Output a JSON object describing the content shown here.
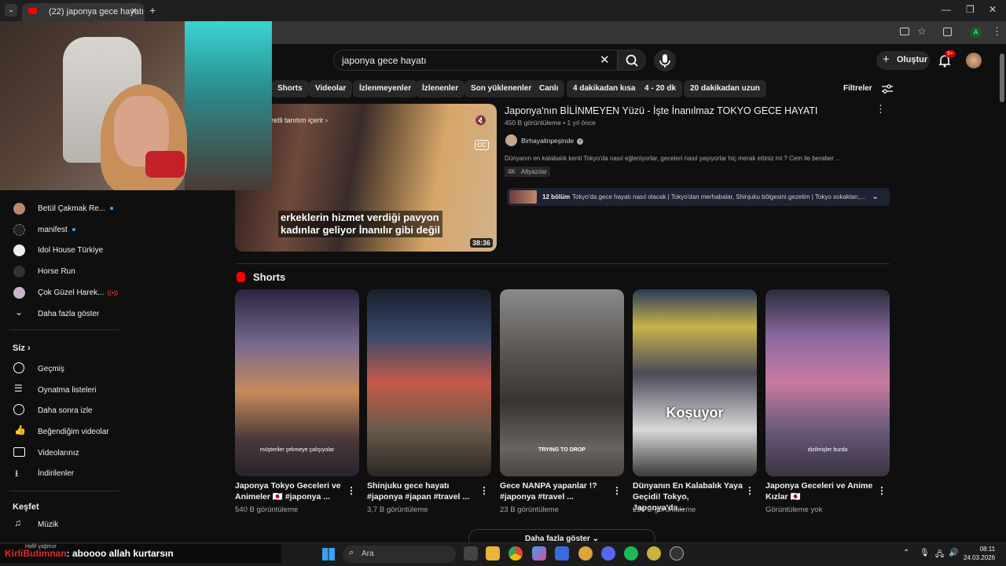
{
  "browser": {
    "tab_title": "(22) japonya gece hayatı - YouT",
    "new_tab": "+",
    "minimize": "—",
    "restore": "❐",
    "close": "✕",
    "profile_initial": "A"
  },
  "header": {
    "search_value": "japonya gece hayatı",
    "create_label": "Oluştur",
    "notifications_badge": "9+"
  },
  "filters": {
    "chips": [
      "Shorts",
      "Videolar",
      "İzlenmeyenler",
      "İzlenenler",
      "Son yüklenenler",
      "Canlı",
      "4 dakikadan kısa",
      "4 - 20 dk",
      "20 dakikadan uzun"
    ],
    "filters_label": "Filtreler"
  },
  "video": {
    "title": "Japonya'nın BİLİNMEYEN Yüzü - İşte İnanılmaz TOKYO GECE HAYATI",
    "views": "450 B görüntüleme",
    "age": "1 yıl önce",
    "channel": "Birhayalinpeşinde",
    "description": "Dünyanın en kalabalık kenti Tokyo'da nasıl eğleniyorlar, geceleri nasıl yaşıyorlar hiç merak ettiniz mi ? Cem ile beraber ...",
    "badges": [
      "4K",
      "Altyazılar"
    ],
    "thumb_overlay_line1": "erkeklerin hizmet verdiği pavyon",
    "thumb_overlay_line2": "kadınlar geliyor İnanılır gibi değil",
    "promo_label": "retli tanıtım içerir",
    "duration": "38:36",
    "chapters_count": "12 bölüm",
    "chapters_text": "Tokyo'da gece hayatı nasıl olacak | Tokyo'dan merhabalar, Shinjuku bölgesini gezelim | Tokyo sokakları,..."
  },
  "sidebar": {
    "subscriptions": [
      {
        "label": "Betül Çakmak Re...",
        "dot": true
      },
      {
        "label": "manifest",
        "dot": true
      },
      {
        "label": "Idol House Türkiye",
        "dot": false
      },
      {
        "label": "Horse Run",
        "dot": false
      },
      {
        "label": "Çok Güzel Harek...",
        "dot": false,
        "live": true
      }
    ],
    "show_more": "Daha fazla göster",
    "you_heading": "Siz",
    "you_items": [
      "Geçmiş",
      "Oynatma listeleri",
      "Daha sonra izle",
      "Beğendiğim videolar",
      "Videolarınız",
      "İndirilenler"
    ],
    "explore_heading": "Keşfet",
    "explore_items": [
      "Müzik"
    ]
  },
  "shorts": {
    "heading": "Shorts",
    "items": [
      {
        "title": "Japonya Tokyo Geceleri ve Animeler 🇯🇵 #japonya ...",
        "views": "540 B görüntüleme",
        "caption": "müşteriler çekmeye çalışıyolar"
      },
      {
        "title": "Shinjuku gece hayatı #japonya #japan #travel ...",
        "views": "3,7 B görüntüleme",
        "caption": ""
      },
      {
        "title": "Gece NANPA yapanlar !? #japonya #travel ...",
        "views": "23 B görüntüleme",
        "caption": "TRYING TO DROP"
      },
      {
        "title": "Dünyanın En Kalabalık Yaya Geçidi! Tokyo, Japonya'da...",
        "views": "236 B görüntüleme",
        "caption": "Koşuyor"
      },
      {
        "title": "Japonya Geceleri ve Anime Kızlar 🇯🇵",
        "views": "Görüntüleme yok",
        "caption": "dizilmişler burda"
      }
    ],
    "show_more": "Daha fazla göster"
  },
  "chat": {
    "user": "KirliButimnan",
    "message": ": aboooo allah kurtarsın"
  },
  "taskbar": {
    "search_label": "Ara",
    "time": "08:11",
    "date": "24.03.2026",
    "weather": "Hafif yağmur"
  },
  "colors": {
    "background": "#0f0f0f",
    "accent_red": "#ff0000",
    "chip_bg": "#272727",
    "link_blue": "#3ea6ff"
  }
}
